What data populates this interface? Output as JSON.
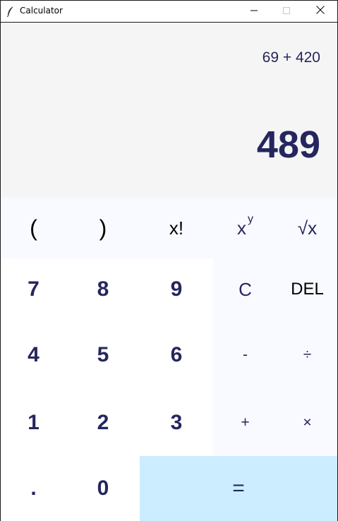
{
  "window": {
    "title": "Calculator",
    "icon": "feather-icon",
    "controls": [
      "minimize-icon",
      "maximize-icon",
      "close-icon"
    ]
  },
  "display": {
    "expression": "69 + 420",
    "result": "489"
  },
  "buttons": {
    "open_paren": "(",
    "close_paren": ")",
    "factorial": "x!",
    "power_base": "x",
    "power_exp": "y",
    "sqrt": "√x",
    "seven": "7",
    "eight": "8",
    "nine": "9",
    "clear": "C",
    "delete": "DEL",
    "four": "4",
    "five": "5",
    "six": "6",
    "minus": "-",
    "divide": "÷",
    "one": "1",
    "two": "2",
    "three": "3",
    "plus": "+",
    "multiply": "×",
    "dot": ".",
    "zero": "0",
    "equals": "="
  },
  "colors": {
    "text": "#25265e",
    "display_bg": "#f5f5f5",
    "function_bg": "#f8faff",
    "digit_bg": "#ffffff",
    "equals_bg": "#ccedff"
  }
}
